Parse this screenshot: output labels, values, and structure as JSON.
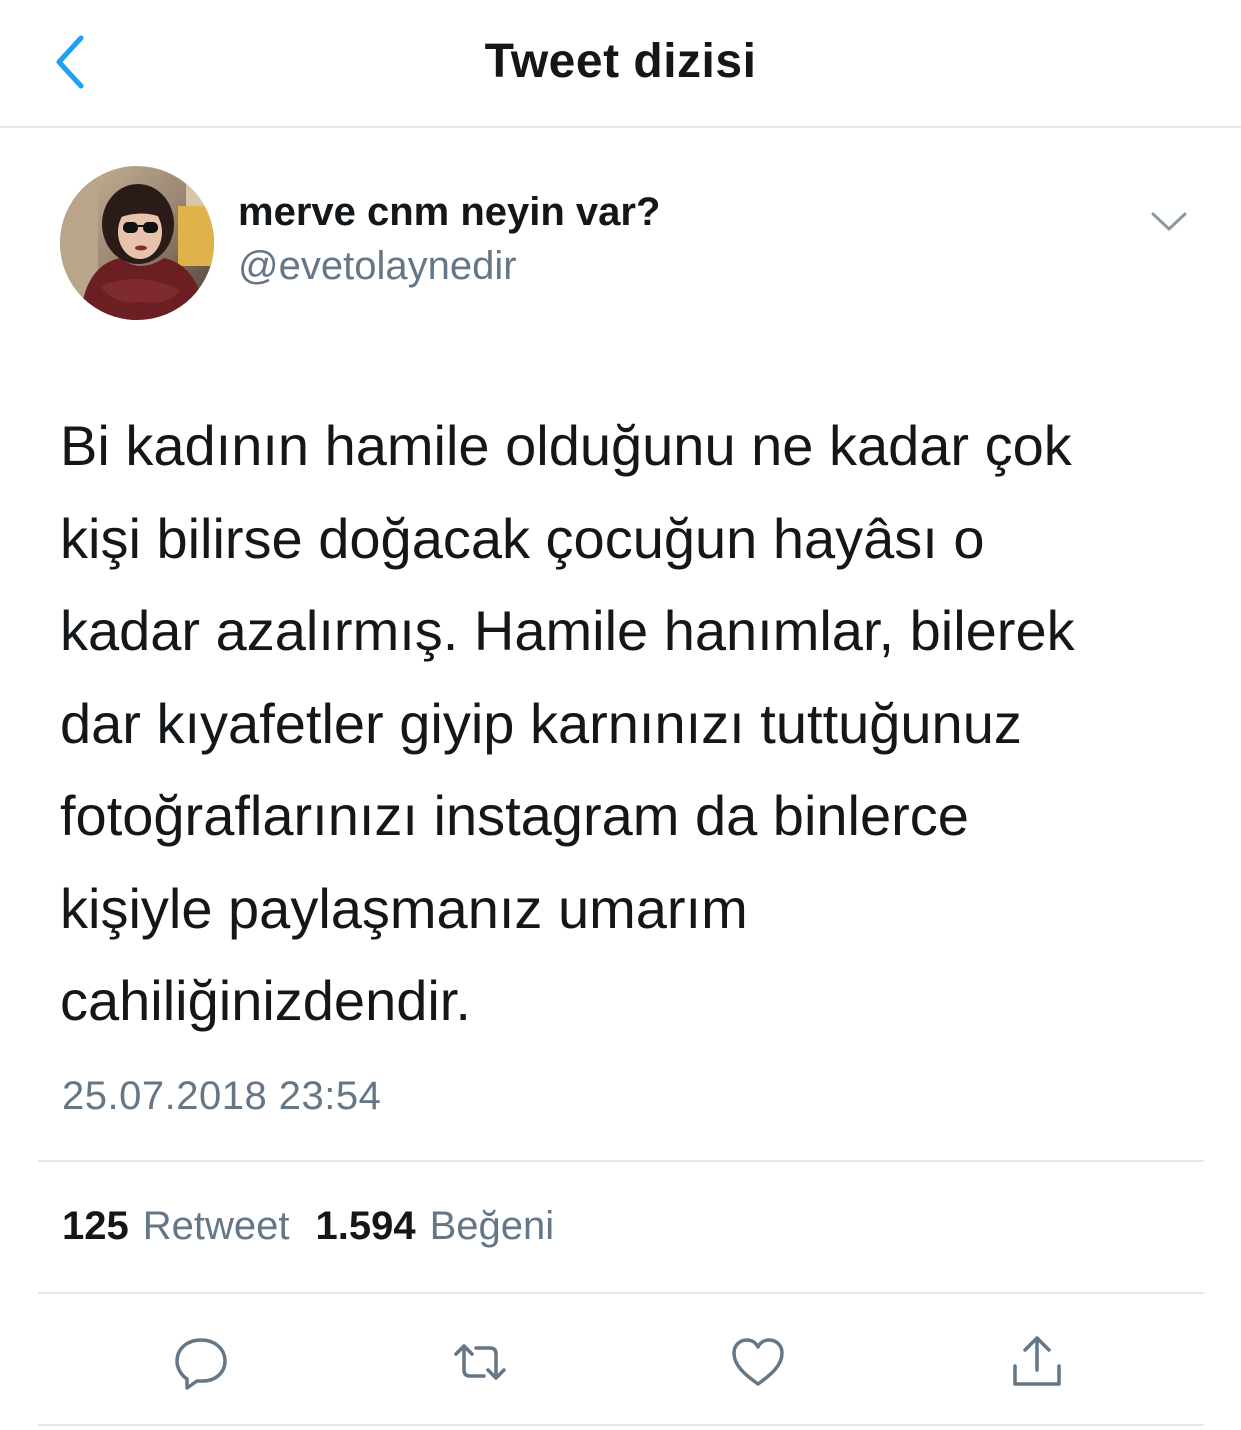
{
  "header": {
    "title": "Tweet dizisi",
    "back_icon": "chevron-left-icon",
    "accent_color": "#1da1f2"
  },
  "tweet": {
    "author": {
      "display_name": "merve cnm neyin var?",
      "handle": "@evetolaynedir"
    },
    "text_lines": [
      "Bi kadının hamile olduğunu ne kadar çok",
      "kişi bilirse doğacak çocuğun hayâsı o",
      "kadar azalırmış. Hamile hanımlar, bilerek",
      "dar kıyafetler giyip karnınızı tuttuğunuz",
      "fotoğraflarınızı instagram da binlerce",
      "kişiyle paylaşmanız umarım",
      "cahiliğinizdendir."
    ],
    "timestamp": "25.07.2018 23:54",
    "stats": {
      "retweets": "125",
      "retweets_label": "Retweet",
      "likes": "1.594",
      "likes_label": "Beğeni"
    }
  },
  "actions": {
    "reply_icon": "reply-icon",
    "retweet_icon": "retweet-icon",
    "like_icon": "heart-icon",
    "share_icon": "share-icon",
    "icon_color": "#657786"
  },
  "colors": {
    "text": "#14171a",
    "secondary": "#657786",
    "divider": "#e1e8ed"
  }
}
